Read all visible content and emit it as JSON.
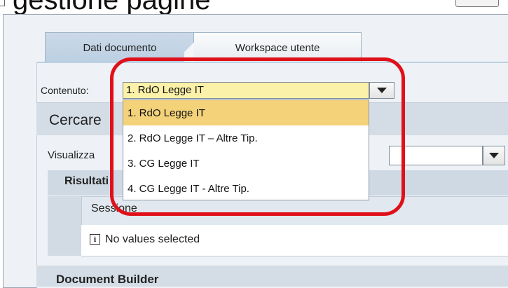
{
  "header": {
    "cropped_title": "gestione pagine"
  },
  "tabs": [
    {
      "label": "Dati documento",
      "active": true
    },
    {
      "label": "Workspace utente",
      "active": false
    }
  ],
  "content": {
    "label": "Contenuto:",
    "value": "1. RdO Legge IT",
    "options": [
      "1. RdO Legge IT",
      "2. RdO Legge IT – Altre Tip.",
      "3. CG Legge IT",
      "4. CG Legge IT - Altre Tip."
    ],
    "selected_index": 0
  },
  "search": {
    "title": "Cercare"
  },
  "view": {
    "label": "Visualizza"
  },
  "results": {
    "title": "Risultati",
    "column": "Sessione",
    "empty_message": "No values selected"
  },
  "builder": {
    "title": "Document Builder"
  },
  "colors": {
    "highlight": "#e0101a",
    "selected_option": "#f4d27a",
    "combo_background": "#fbf1a8",
    "active_tab": "#bcd0e3"
  },
  "icons": [
    "dropdown-arrow-icon",
    "info-icon"
  ]
}
